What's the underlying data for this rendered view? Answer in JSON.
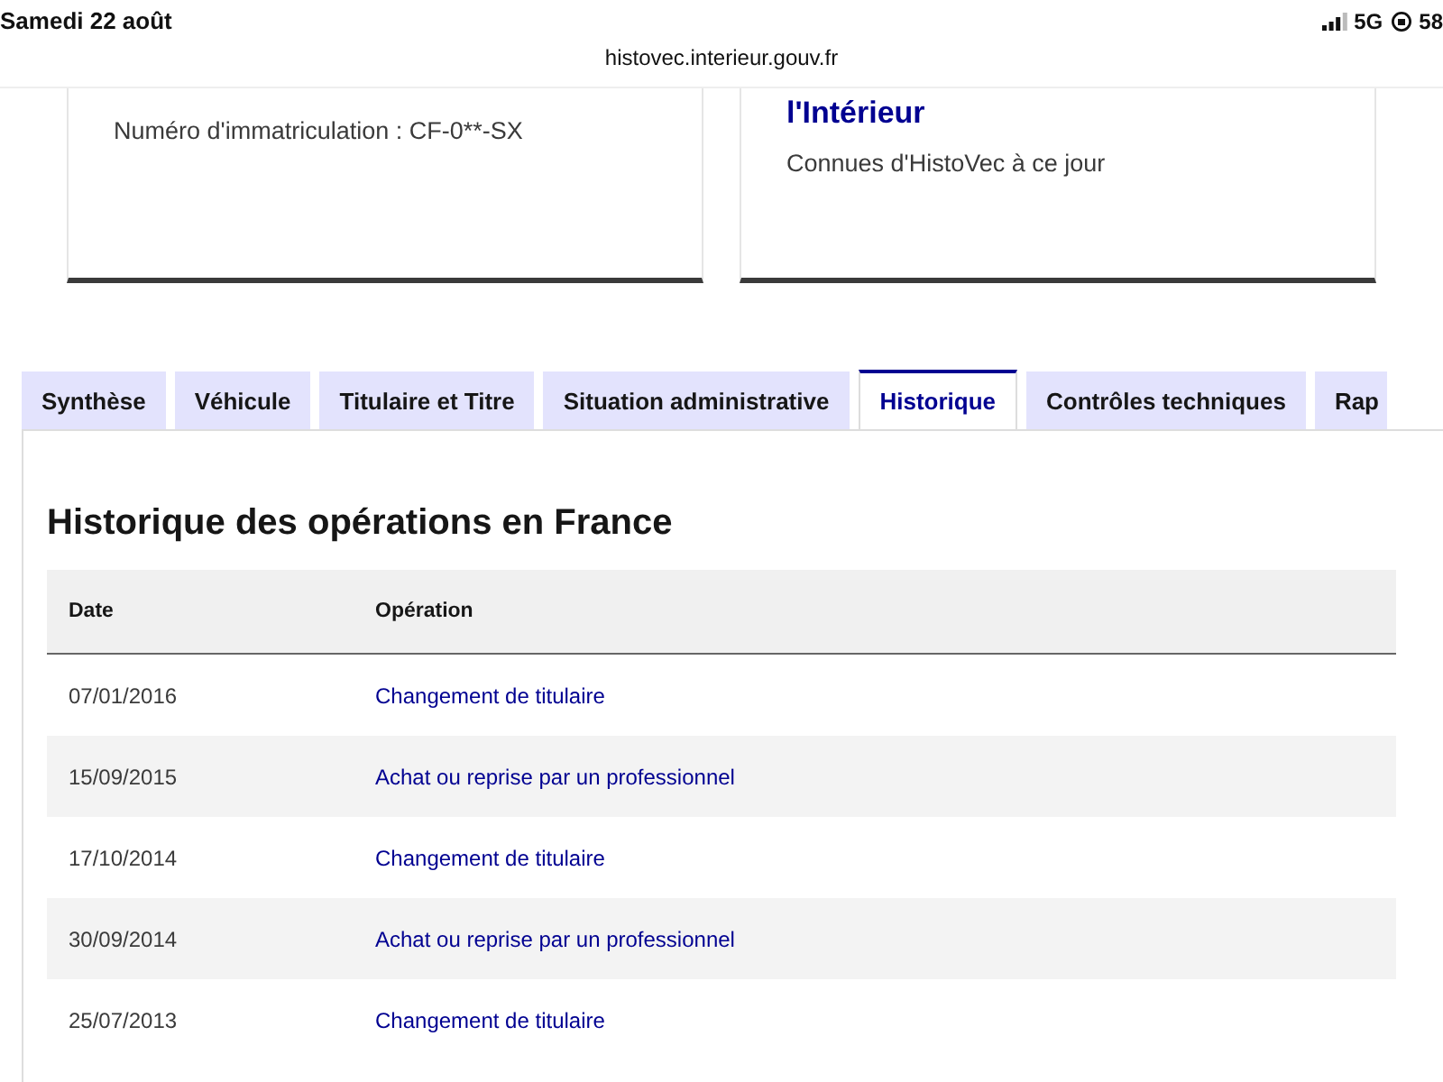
{
  "status_bar": {
    "date": "Samedi 22 août",
    "url": "histovec.interieur.gouv.fr",
    "network": "5G",
    "battery": "58"
  },
  "cards": [
    {
      "subtitle": "Numéro d'immatriculation : CF-0**-SX"
    },
    {
      "title": "l'Intérieur",
      "subtitle": "Connues d'HistoVec à ce jour"
    }
  ],
  "tabs": [
    {
      "label": "Synthèse",
      "selected": false
    },
    {
      "label": "Véhicule",
      "selected": false
    },
    {
      "label": "Titulaire et Titre",
      "selected": false
    },
    {
      "label": "Situation administrative",
      "selected": false
    },
    {
      "label": "Historique",
      "selected": true
    },
    {
      "label": "Contrôles techniques",
      "selected": false
    },
    {
      "label": "Rap",
      "selected": false
    }
  ],
  "section": {
    "title": "Historique des opérations en France"
  },
  "table": {
    "columns": [
      "Date",
      "Opération"
    ],
    "rows": [
      {
        "date": "07/01/2016",
        "operation": "Changement de titulaire"
      },
      {
        "date": "15/09/2015",
        "operation": "Achat ou reprise par un professionnel"
      },
      {
        "date": "17/10/2014",
        "operation": "Changement de titulaire"
      },
      {
        "date": "30/09/2014",
        "operation": "Achat ou reprise par un professionnel"
      },
      {
        "date": "25/07/2013",
        "operation": "Changement de titulaire"
      }
    ]
  }
}
